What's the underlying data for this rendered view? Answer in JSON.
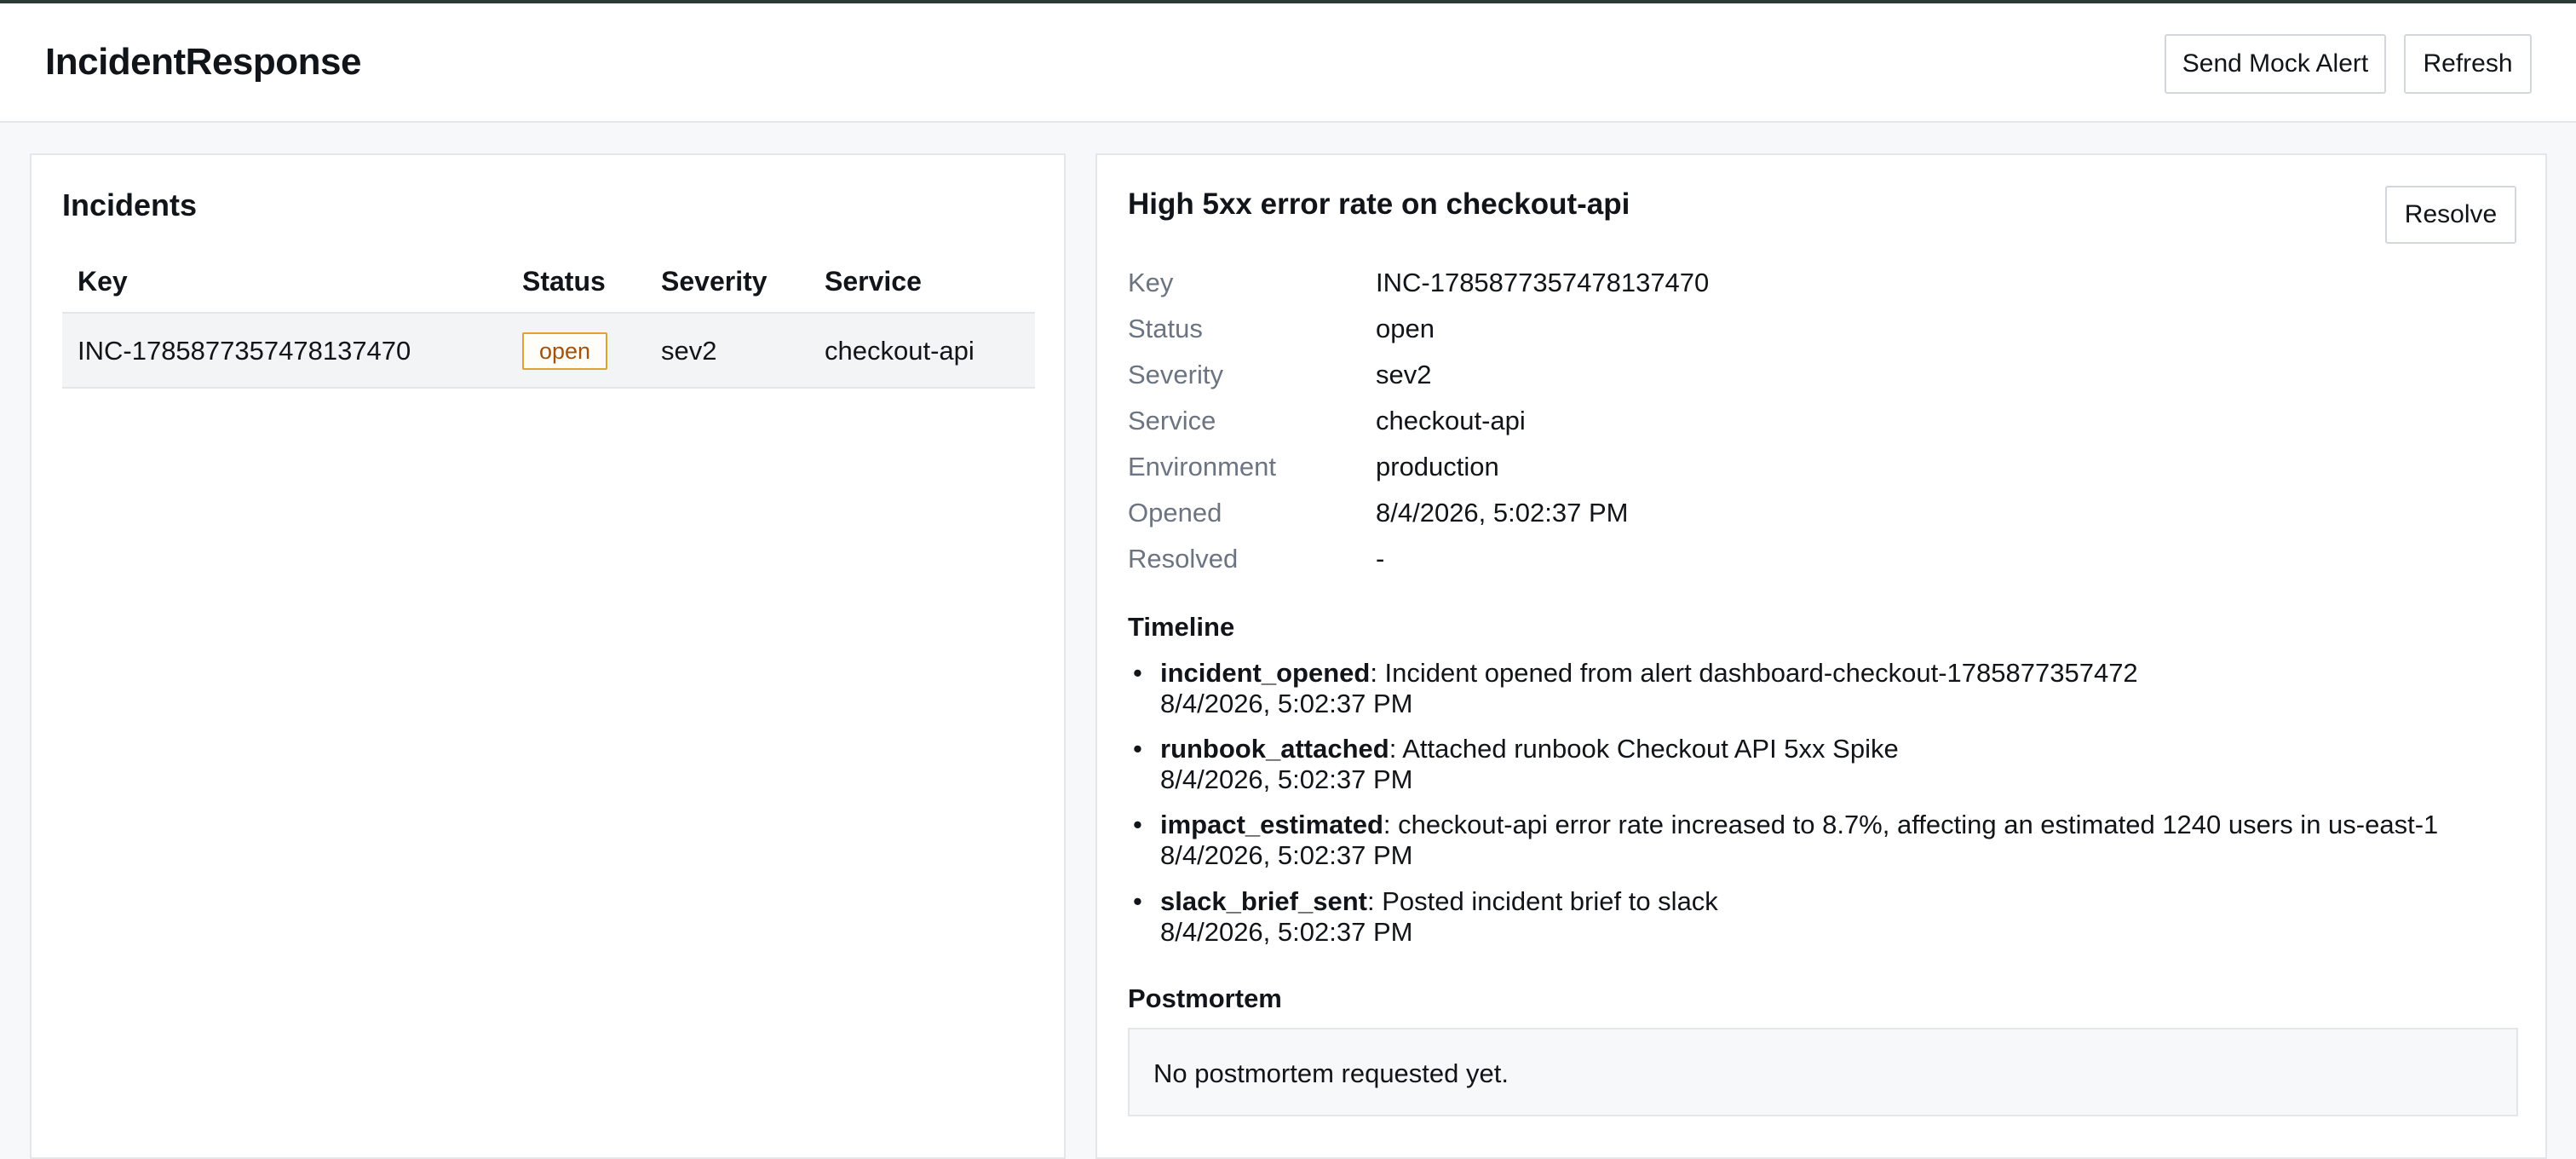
{
  "app": {
    "title": "IncidentResponse"
  },
  "header": {
    "send_mock_alert": "Send Mock Alert",
    "refresh": "Refresh"
  },
  "incidents": {
    "title": "Incidents",
    "columns": [
      "Key",
      "Status",
      "Severity",
      "Service"
    ],
    "rows": [
      {
        "key": "INC-1785877357478137470",
        "status": "open",
        "severity": "sev2",
        "service": "checkout-api"
      }
    ]
  },
  "detail": {
    "title": "High 5xx error rate on checkout-api",
    "resolve_label": "Resolve",
    "fields": [
      {
        "label": "Key",
        "value": "INC-1785877357478137470"
      },
      {
        "label": "Status",
        "value": "open"
      },
      {
        "label": "Severity",
        "value": "sev2"
      },
      {
        "label": "Service",
        "value": "checkout-api"
      },
      {
        "label": "Environment",
        "value": "production"
      },
      {
        "label": "Opened",
        "value": "8/4/2026, 5:02:37 PM"
      },
      {
        "label": "Resolved",
        "value": "-"
      }
    ],
    "timeline_title": "Timeline",
    "timeline": [
      {
        "event": "incident_opened",
        "message": ": Incident opened from alert dashboard-checkout-1785877357472",
        "time": "8/4/2026, 5:02:37 PM"
      },
      {
        "event": "runbook_attached",
        "message": ": Attached runbook Checkout API 5xx Spike",
        "time": "8/4/2026, 5:02:37 PM"
      },
      {
        "event": "impact_estimated",
        "message": ": checkout-api error rate increased to 8.7%, affecting an estimated 1240 users in us-east-1",
        "time": "8/4/2026, 5:02:37 PM"
      },
      {
        "event": "slack_brief_sent",
        "message": ": Posted incident brief to slack",
        "time": "8/4/2026, 5:02:37 PM"
      }
    ],
    "postmortem_title": "Postmortem",
    "postmortem_text": "No postmortem requested yet."
  },
  "colors": {
    "status_open_border": "#e0a233",
    "status_open_text": "#a1520f"
  }
}
